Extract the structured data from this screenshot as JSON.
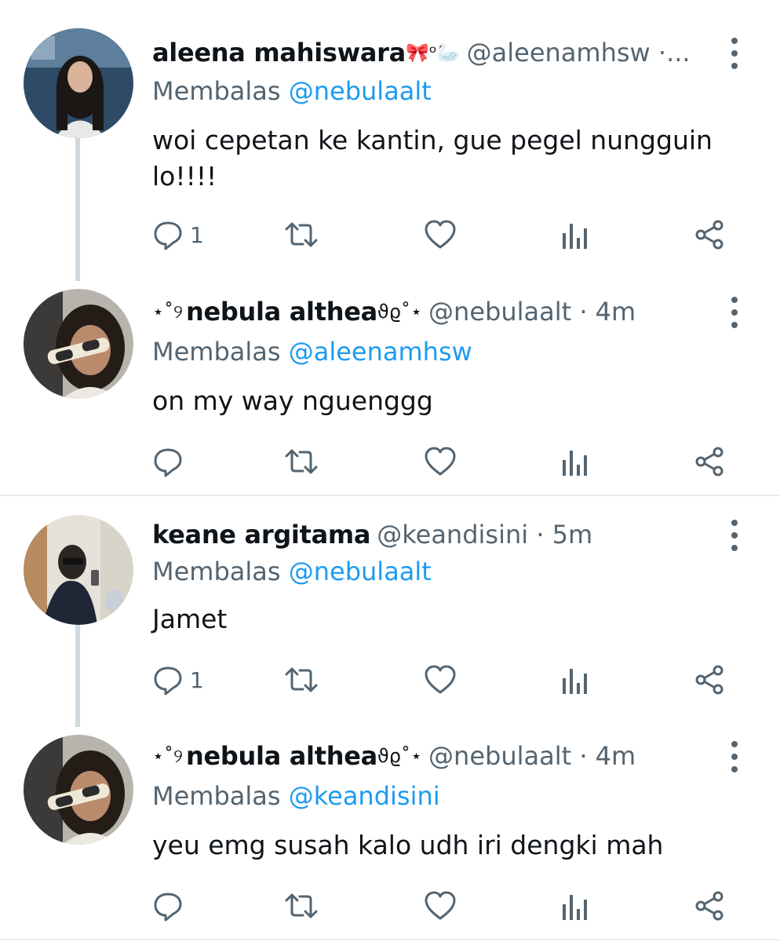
{
  "tweets": [
    {
      "name": "aleena mahiswara",
      "name_deco": "🎀ᵒ🦢",
      "handle": "@aleenamhsw ·...",
      "reply_prefix": "Membalas",
      "reply_mention": "@nebulaalt",
      "text_lines": [
        "woi cepetan ke kantin, gue pegel nungguin",
        "lo!!!!"
      ],
      "reply_count": "1"
    },
    {
      "name_prefix": "⋆˚୨",
      "name": "nebula althea",
      "name_deco": "ϑϱ˚⋆",
      "handle": "@nebulaalt · 4m",
      "reply_prefix": "Membalas",
      "reply_mention": "@aleenamhsw",
      "text_lines": [
        "on my way nguenggg"
      ],
      "reply_count": ""
    },
    {
      "name": "keane argitama",
      "handle": "@keandisini · 5m",
      "reply_prefix": "Membalas",
      "reply_mention": "@nebulaalt",
      "text_lines": [
        "Jamet"
      ],
      "reply_count": "1"
    },
    {
      "name_prefix": "⋆˚୨",
      "name": "nebula althea",
      "name_deco": "ϑϱ˚⋆",
      "handle": "@nebulaalt · 4m",
      "reply_prefix": "Membalas",
      "reply_mention": "@keandisini",
      "text_lines": [
        "yeu emg susah kalo udh iri dengki mah"
      ],
      "reply_count": ""
    }
  ],
  "icons": [
    "reply-icon",
    "retweet-icon",
    "like-icon",
    "views-icon",
    "share-icon",
    "more-icon"
  ],
  "colors": {
    "mention": "#1d9bf0",
    "secondary": "#536471",
    "line": "#cfd9de"
  }
}
